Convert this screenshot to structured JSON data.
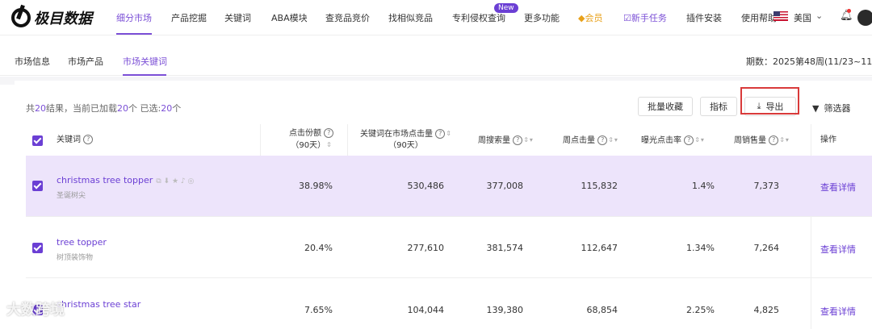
{
  "brand": "极目数据",
  "nav": [
    {
      "label": "细分市场",
      "active": true
    },
    {
      "label": "产品挖掘"
    },
    {
      "label": "关键词"
    },
    {
      "label": "ABA模块"
    },
    {
      "label": "查竞品竞价"
    },
    {
      "label": "找相似竞品"
    },
    {
      "label": "专利侵权查询"
    },
    {
      "label": "更多功能"
    },
    {
      "label": "会员"
    },
    {
      "label": "新手任务"
    },
    {
      "label": "插件安装"
    },
    {
      "label": "使用帮助"
    }
  ],
  "new_badge": "New",
  "vip_icon": "diamond-icon",
  "task_icon": "checkbox-icon",
  "region": "美国",
  "subtabs": [
    "市场信息",
    "市场产品",
    "市场关键词"
  ],
  "period": "期数：2025第48周(11/23~11/",
  "summary": {
    "prefix": "共",
    "total": "20",
    "mid": "结果，当前已加载",
    "loaded": "20",
    "mid2": "个   已选:",
    "selected": "20",
    "suffix": "个"
  },
  "toolbar": {
    "batch_collect": "批量收藏",
    "metrics": "指标",
    "export": "导出",
    "filter": "筛选器"
  },
  "columns": {
    "keyword": "关键词",
    "click_share_1": "点击份额",
    "click_share_2": "（90天）",
    "market_clicks_1": "关键词在市场点击量",
    "market_clicks_2": "（90天）",
    "weekly_search": "周搜索量",
    "weekly_clicks": "周点击量",
    "ctr": "曝光点击率",
    "weekly_sales": "周销售量",
    "action": "操作"
  },
  "rows": [
    {
      "keyword": "christmas tree topper",
      "zh": "圣诞树尖",
      "click_share": "38.98%",
      "market_clicks": "530,486",
      "weekly_search": "377,008",
      "weekly_clicks": "115,832",
      "ctr": "1.4%",
      "weekly_sales": "7,373",
      "action": "查看详情"
    },
    {
      "keyword": "tree topper",
      "zh": "树顶装饰物",
      "click_share": "20.4%",
      "market_clicks": "277,610",
      "weekly_search": "381,574",
      "weekly_clicks": "112,647",
      "ctr": "1.34%",
      "weekly_sales": "7,264",
      "action": "查看详情"
    },
    {
      "keyword": "christmas tree star",
      "zh": "",
      "click_share": "7.65%",
      "market_clicks": "104,044",
      "weekly_search": "139,380",
      "weekly_clicks": "68,854",
      "ctr": "2.25%",
      "weekly_sales": "4,825",
      "action": "查看详情"
    }
  ],
  "watermark": "大数跨境",
  "colors": {
    "accent": "#6b3fd4",
    "selected_row": "#ede4fb",
    "highlight_box": "#d93a3a"
  }
}
